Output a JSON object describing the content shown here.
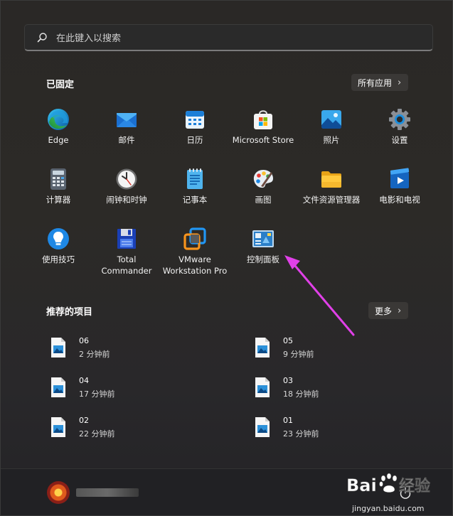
{
  "search": {
    "placeholder": "在此键入以搜索"
  },
  "pinned": {
    "title": "已固定",
    "all_apps_label": "所有应用",
    "apps": [
      {
        "label": "Edge",
        "icon": "edge-icon"
      },
      {
        "label": "邮件",
        "icon": "mail-icon"
      },
      {
        "label": "日历",
        "icon": "calendar-icon"
      },
      {
        "label": "Microsoft Store",
        "icon": "store-icon"
      },
      {
        "label": "照片",
        "icon": "photos-icon"
      },
      {
        "label": "设置",
        "icon": "gear-icon"
      },
      {
        "label": "计算器",
        "icon": "calculator-icon"
      },
      {
        "label": "闹钟和时钟",
        "icon": "clock-icon"
      },
      {
        "label": "记事本",
        "icon": "notepad-icon"
      },
      {
        "label": "画图",
        "icon": "paint-icon"
      },
      {
        "label": "文件资源管理器",
        "icon": "folder-icon"
      },
      {
        "label": "电影和电视",
        "icon": "movies-icon"
      },
      {
        "label": "使用技巧",
        "icon": "tips-icon"
      },
      {
        "label": "Total Commander",
        "icon": "total-commander-icon"
      },
      {
        "label": "VMware Workstation Pro",
        "icon": "vmware-icon"
      },
      {
        "label": "控制面板",
        "icon": "control-panel-icon"
      }
    ]
  },
  "recommended": {
    "title": "推荐的项目",
    "more_label": "更多",
    "items": [
      {
        "name": "06",
        "time": "2 分钟前"
      },
      {
        "name": "05",
        "time": "9 分钟前"
      },
      {
        "name": "04",
        "time": "17 分钟前"
      },
      {
        "name": "03",
        "time": "18 分钟前"
      },
      {
        "name": "02",
        "time": "22 分钟前"
      },
      {
        "name": "01",
        "time": "23 分钟前"
      }
    ]
  },
  "watermark": {
    "brand": "Baidu经验",
    "url": "jingyan.baidu.com"
  },
  "colors": {
    "annotation_arrow": "#e040e8",
    "accent": "#0a84d8"
  }
}
